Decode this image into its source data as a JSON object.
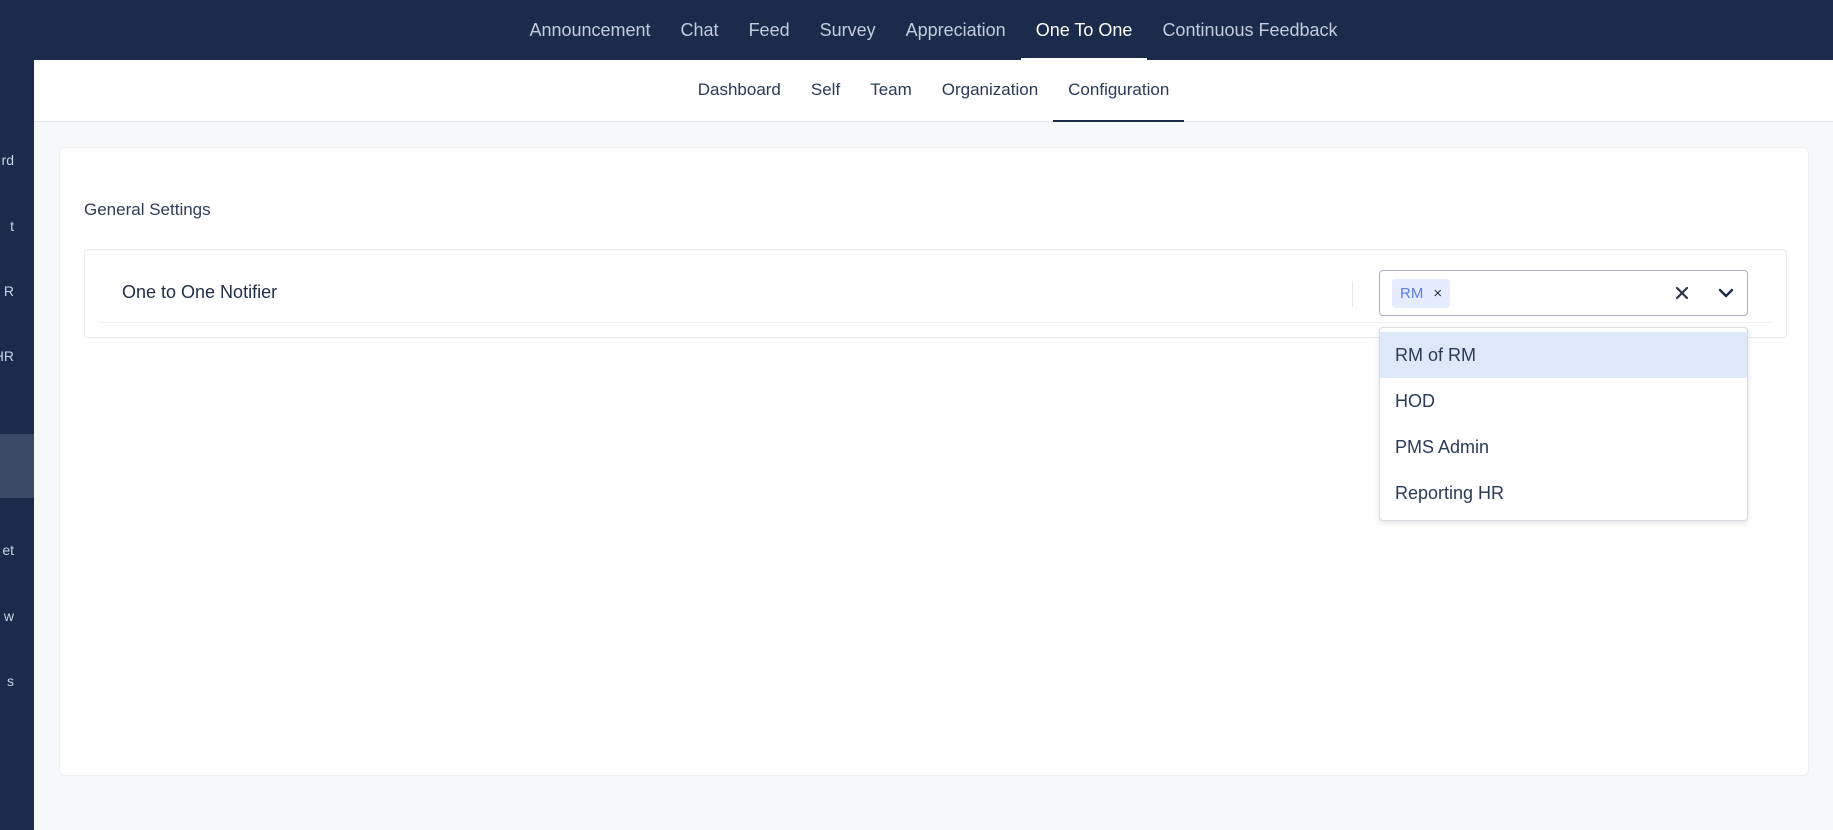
{
  "top_nav": {
    "tabs": [
      {
        "label": "Announcement"
      },
      {
        "label": "Chat"
      },
      {
        "label": "Feed"
      },
      {
        "label": "Survey"
      },
      {
        "label": "Appreciation"
      },
      {
        "label": "One To One",
        "active": true
      },
      {
        "label": "Continuous Feedback"
      }
    ]
  },
  "sub_nav": {
    "tabs": [
      {
        "label": "Dashboard"
      },
      {
        "label": "Self"
      },
      {
        "label": "Team"
      },
      {
        "label": "Organization"
      },
      {
        "label": "Configuration",
        "active": true
      }
    ]
  },
  "sidebar": {
    "items": [
      {
        "label": "rd"
      },
      {
        "label": "t"
      },
      {
        "label": "R"
      },
      {
        "label": "HR"
      },
      {
        "label": "et"
      },
      {
        "label": "w"
      },
      {
        "label": "s"
      }
    ]
  },
  "settings": {
    "section_title": "General Settings",
    "notifier_label": "One to One Notifier",
    "selected_chip": "RM",
    "chip_remove": "×",
    "options": [
      {
        "label": "RM of RM",
        "highlighted": true
      },
      {
        "label": "HOD"
      },
      {
        "label": "PMS Admin"
      },
      {
        "label": "Reporting HR"
      }
    ]
  },
  "colors": {
    "nav_bg": "#1b2b4b",
    "chip_bg": "#e4ecfd",
    "chip_text": "#5b7fe0",
    "option_highlight": "#dde9fb"
  }
}
